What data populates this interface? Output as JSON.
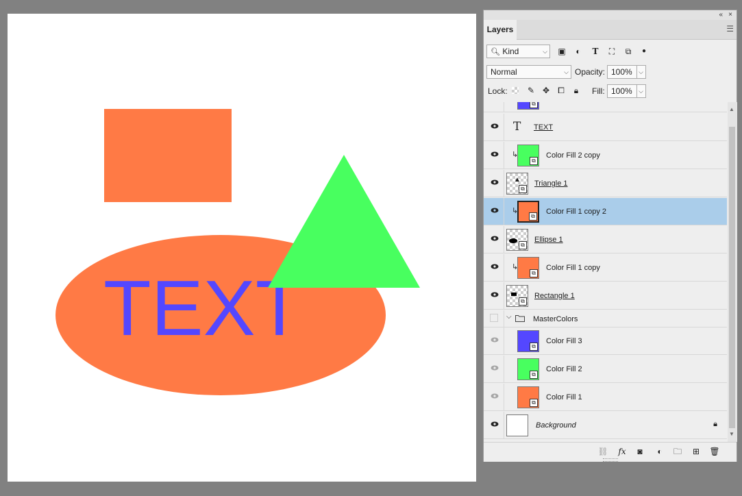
{
  "canvas": {
    "text_layer_content": "TEXT",
    "colors": {
      "orange": "#ff7a45",
      "green": "#48ff5f",
      "blue": "#5447ff",
      "background": "#ffffff"
    }
  },
  "panel": {
    "topbar": {
      "collapse": "«",
      "close": "×"
    },
    "tab": "Layers",
    "menu_icon": "panel-menu-icon",
    "filter": {
      "kind_label": "Kind",
      "icons": [
        "pixel-filter-icon",
        "adjustment-filter-icon",
        "type-filter-icon",
        "shape-filter-icon",
        "smart-object-filter-icon",
        "filter-toggle-icon"
      ]
    },
    "blend": {
      "mode": "Normal",
      "opacity_label": "Opacity:",
      "opacity": "100%"
    },
    "lock": {
      "label": "Lock:",
      "fill_label": "Fill:",
      "fill": "100%"
    },
    "layers": [
      {
        "name": "TEXT",
        "kind": "type",
        "visible": true
      },
      {
        "name": "Color Fill 2 copy",
        "kind": "fill",
        "color": "#48ff5f",
        "clipped": true,
        "visible": true
      },
      {
        "name": "Triangle 1",
        "kind": "smart-shape",
        "visible": true
      },
      {
        "name": "Color Fill 1 copy 2",
        "kind": "fill",
        "color": "#ff7a45",
        "clipped": true,
        "visible": true,
        "selected": true
      },
      {
        "name": "Ellipse 1",
        "kind": "smart-shape",
        "visible": true
      },
      {
        "name": "Color Fill 1 copy",
        "kind": "fill",
        "color": "#ff7a45",
        "clipped": true,
        "visible": true
      },
      {
        "name": "Rectangle 1",
        "kind": "smart-shape",
        "visible": true
      },
      {
        "name": "MasterColors",
        "kind": "group",
        "visible": false
      },
      {
        "name": "Color Fill 3",
        "kind": "fill",
        "color": "#5447ff",
        "visible": true,
        "dimmed": true
      },
      {
        "name": "Color Fill 2",
        "kind": "fill",
        "color": "#48ff5f",
        "visible": true,
        "dimmed": true
      },
      {
        "name": "Color Fill 1",
        "kind": "fill",
        "color": "#ff7a45",
        "visible": true,
        "dimmed": true
      },
      {
        "name": "Background",
        "kind": "background",
        "visible": true,
        "locked": true
      }
    ],
    "footer_icons": [
      "link-layers-icon",
      "fx-icon",
      "layer-mask-icon",
      "adjustment-layer-icon",
      "new-group-icon",
      "new-layer-icon",
      "delete-layer-icon"
    ]
  }
}
